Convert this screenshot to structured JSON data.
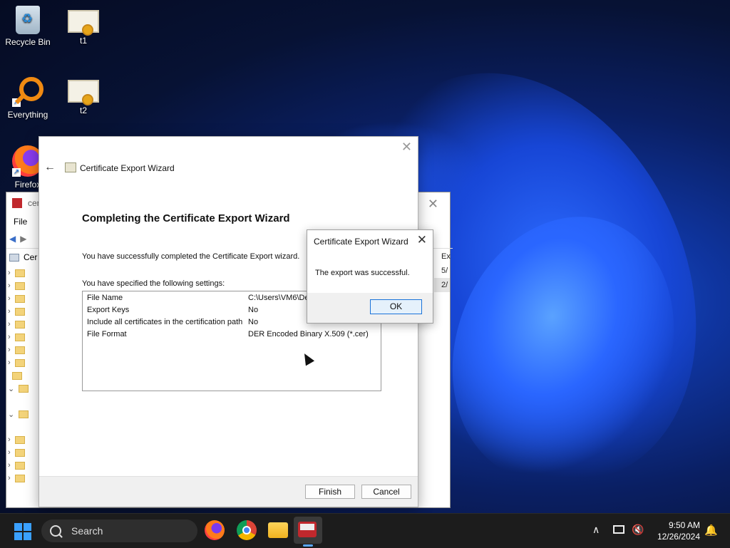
{
  "desktop": {
    "icons": [
      {
        "label": "Recycle Bin"
      },
      {
        "label": "t1"
      },
      {
        "label": "Everything"
      },
      {
        "label": "t2"
      },
      {
        "label": "Firefox"
      }
    ]
  },
  "mmc_window": {
    "title_fragment": "cer",
    "menu": {
      "file": "File"
    },
    "tree_root": "Cer",
    "right_col": [
      "Ex",
      "5/",
      "2/"
    ]
  },
  "wizard": {
    "title": "Certificate Export Wizard",
    "heading": "Completing the Certificate Export Wizard",
    "success_text": "You have successfully completed the Certificate Export wizard.",
    "settings_intro": "You have specified the following settings:",
    "settings": [
      {
        "key": "File Name",
        "value": "C:\\Users\\VM6\\De"
      },
      {
        "key": "Export Keys",
        "value": "No"
      },
      {
        "key": "Include all certificates in the certification path",
        "value": "No"
      },
      {
        "key": "File Format",
        "value": "DER Encoded Binary X.509 (*.cer)"
      }
    ],
    "finish_label": "Finish",
    "cancel_label": "Cancel"
  },
  "message_box": {
    "title": "Certificate Export Wizard",
    "text": "The export was successful.",
    "ok_label": "OK"
  },
  "taskbar": {
    "search_label": "Search",
    "time": "9:50 AM",
    "date": "12/26/2024"
  }
}
